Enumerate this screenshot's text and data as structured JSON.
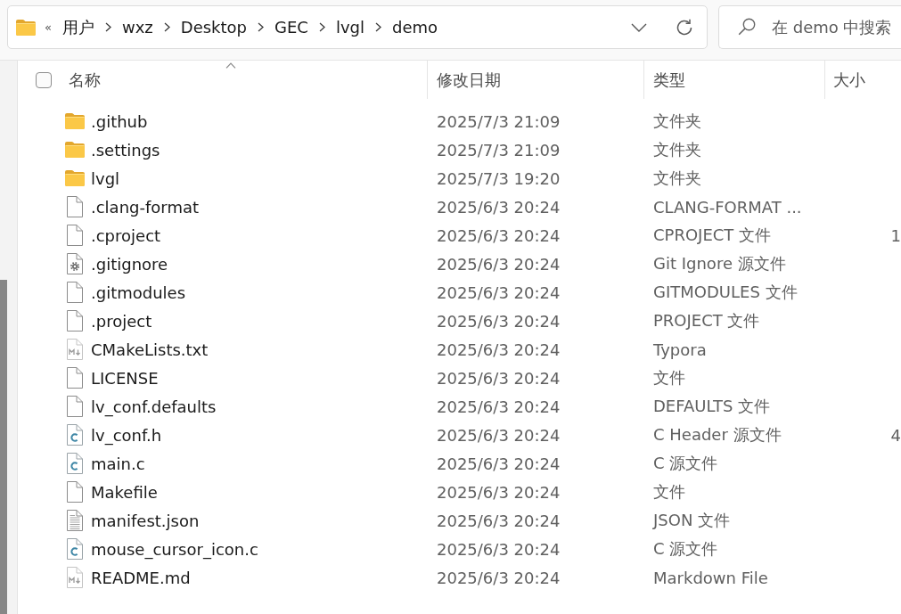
{
  "address_bar": {
    "overflow": "«",
    "breadcrumbs": [
      "用户",
      "wxz",
      "Desktop",
      "GEC",
      "lvgl",
      "demo"
    ]
  },
  "search": {
    "placeholder": "在 demo 中搜索"
  },
  "file_list": {
    "select_all": {
      "checked": false
    },
    "columns": [
      {
        "label": "名称",
        "sorted": true
      },
      {
        "label": "修改日期",
        "sorted": false
      },
      {
        "label": "类型",
        "sorted": false
      },
      {
        "label": "大小",
        "sorted": false
      }
    ],
    "rows": [
      {
        "kind": "folder",
        "name": ".github",
        "modified": "2025/7/3 21:09",
        "type": "文件夹"
      },
      {
        "kind": "folder",
        "name": ".settings",
        "modified": "2025/7/3 21:09",
        "type": "文件夹"
      },
      {
        "kind": "folder",
        "name": "lvgl",
        "modified": "2025/7/3 19:20",
        "type": "文件夹"
      },
      {
        "kind": "file",
        "name": ".clang-format",
        "modified": "2025/6/3 20:24",
        "type": "CLANG-FORMAT ..."
      },
      {
        "kind": "file",
        "name": ".cproject",
        "modified": "2025/6/3 20:24",
        "type": "CPROJECT 文件",
        "size": "1"
      },
      {
        "kind": "settings",
        "name": ".gitignore",
        "modified": "2025/6/3 20:24",
        "type": "Git Ignore 源文件"
      },
      {
        "kind": "file",
        "name": ".gitmodules",
        "modified": "2025/6/3 20:24",
        "type": "GITMODULES 文件"
      },
      {
        "kind": "file",
        "name": ".project",
        "modified": "2025/6/3 20:24",
        "type": "PROJECT 文件"
      },
      {
        "kind": "markdown",
        "name": "CMakeLists.txt",
        "modified": "2025/6/3 20:24",
        "type": "Typora"
      },
      {
        "kind": "file",
        "name": "LICENSE",
        "modified": "2025/6/3 20:24",
        "type": "文件"
      },
      {
        "kind": "file",
        "name": "lv_conf.defaults",
        "modified": "2025/6/3 20:24",
        "type": "DEFAULTS 文件"
      },
      {
        "kind": "source",
        "name": "lv_conf.h",
        "modified": "2025/6/3 20:24",
        "type": "C Header 源文件",
        "size": "4"
      },
      {
        "kind": "source",
        "name": "main.c",
        "modified": "2025/6/3 20:24",
        "type": "C 源文件"
      },
      {
        "kind": "file",
        "name": "Makefile",
        "modified": "2025/6/3 20:24",
        "type": "文件"
      },
      {
        "kind": "text",
        "name": "manifest.json",
        "modified": "2025/6/3 20:24",
        "type": "JSON 文件"
      },
      {
        "kind": "source",
        "name": "mouse_cursor_icon.c",
        "modified": "2025/6/3 20:24",
        "type": "C 源文件"
      },
      {
        "kind": "markdown",
        "name": "README.md",
        "modified": "2025/6/3 20:24",
        "type": "Markdown File"
      }
    ]
  }
}
